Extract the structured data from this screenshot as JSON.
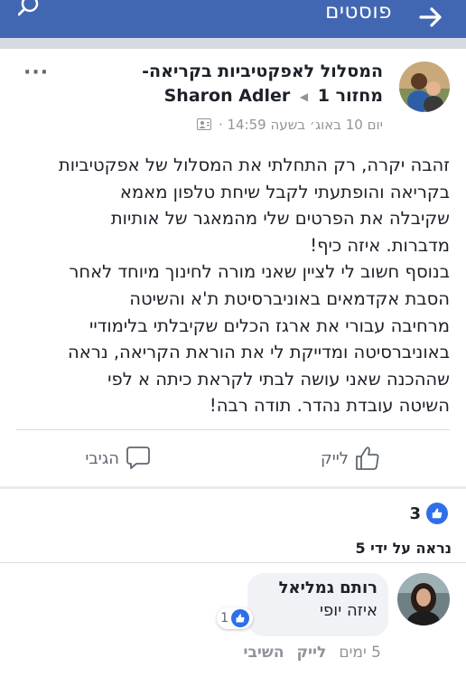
{
  "header": {
    "title": "פוסטים",
    "bg_color": "#4267b2",
    "back_icon": "arrow-right-icon",
    "search_icon": "search-icon"
  },
  "post": {
    "group_name": "המסלול לאפקטיביות בקריאה-",
    "group_name_cont": "מחזור",
    "author": "Sharon Adler",
    "author_count": "1",
    "timestamp": "יום 10 באוג׳ בשעה 14:59",
    "privacy_icon": "group-icon",
    "more_label": "···",
    "body_lines": [
      "זהבה יקרה, רק התחלתי את המסלול של אפקטיביות",
      "בקריאה והופתעתי לקבל שיחת טלפון מאמא",
      "שקיבלה את הפרטים שלי מהמאגר של אותיות",
      "מדברות. איזה כיף!",
      "בנוסף חשוב לי לציין שאני מורה לחינוך מיוחד לאחר",
      "הסבת אקדמאים באוניברסיטת ת'א והשיטה",
      "מרחיבה עבורי את ארגז הכלים שקיבלתי בלימודיי",
      "באוניברסיטה ומדייקת לי את הוראת הקריאה, נראה",
      "שההכנה שאני עושה לבתי לקראת כיתה א לפי",
      "השיטה עובדת נהדר. תודה רבה!"
    ],
    "like_label": "לייק",
    "comment_label": "הגיבי"
  },
  "reactions": {
    "count": "3",
    "seen_by": "נראה על ידי 5"
  },
  "comment": {
    "author": "רותם גמליאל",
    "text": "איזה יופי",
    "like_count": "1",
    "time": "5 ימים",
    "like_label": "לייק",
    "reply_label": "השיבי"
  },
  "colors": {
    "like_blue": "#2f6fea",
    "muted": "#90949c",
    "separator": "#d7dae0"
  }
}
